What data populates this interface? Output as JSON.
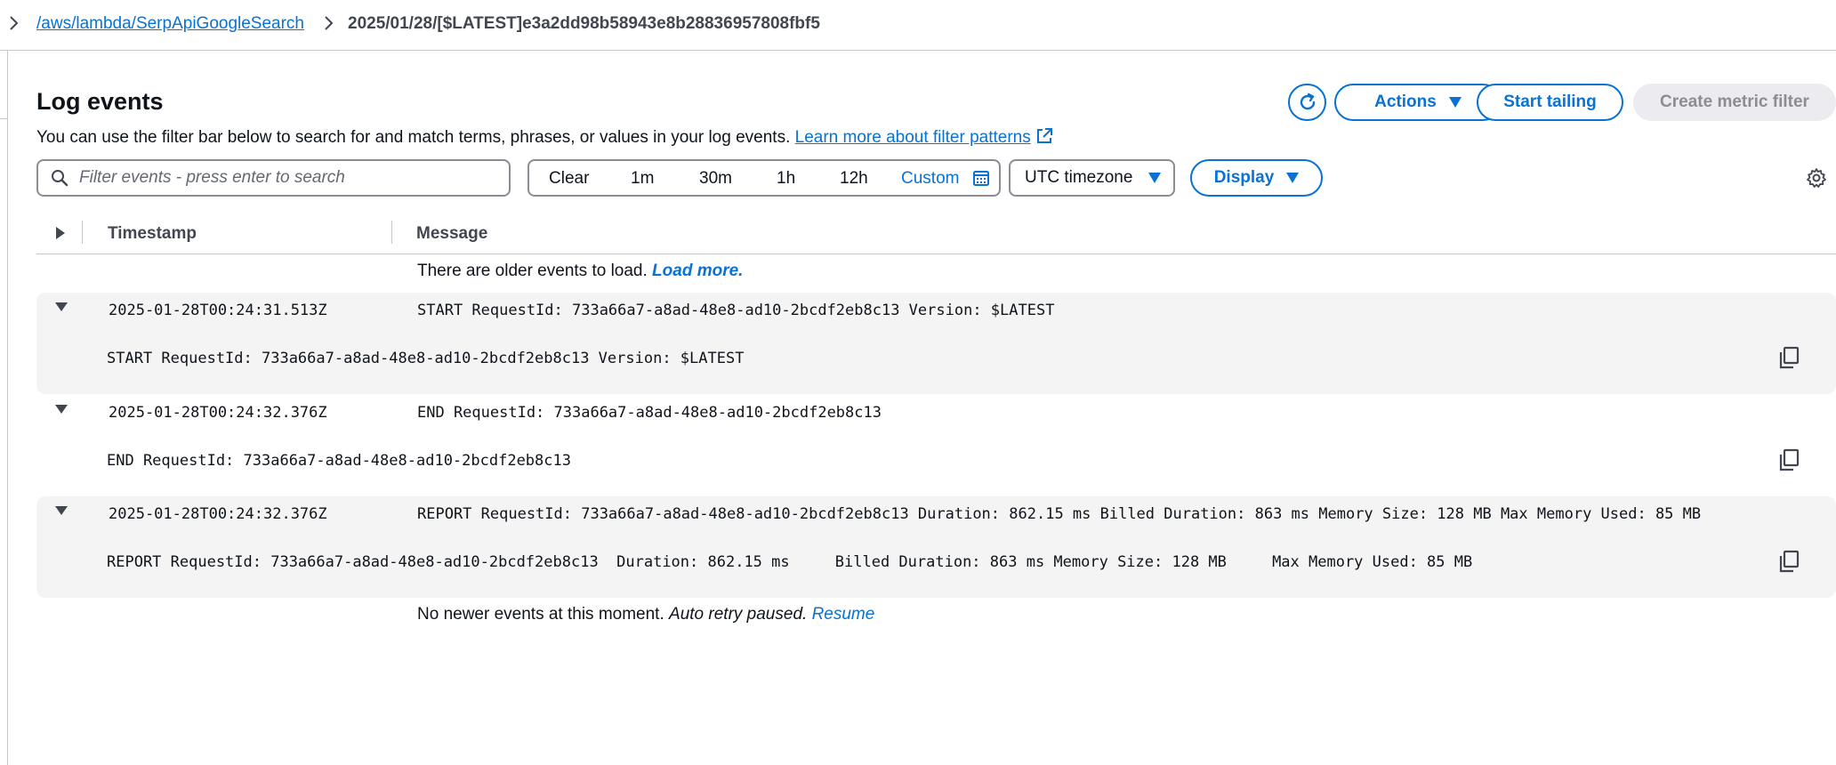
{
  "breadcrumb": {
    "log_group": "/aws/lambda/SerpApiGoogleSearch",
    "log_stream": "2025/01/28/[$LATEST]e3a2dd98b58943e8b28836957808fbf5"
  },
  "header": {
    "title": "Log events",
    "description": "You can use the filter bar below to search for and match terms, phrases, or values in your log events.",
    "learn_more": "Learn more about filter patterns"
  },
  "toolbar": {
    "actions_label": "Actions",
    "start_tailing_label": "Start tailing",
    "create_metric_filter_label": "Create metric filter"
  },
  "filter": {
    "placeholder": "Filter events - press enter to search",
    "range": {
      "clear": "Clear",
      "options": [
        "1m",
        "30m",
        "1h",
        "12h"
      ],
      "custom": "Custom"
    },
    "timezone": "UTC timezone",
    "display_label": "Display"
  },
  "table": {
    "columns": [
      "Timestamp",
      "Message"
    ],
    "older_notice": "There are older events to load.",
    "load_more": "Load more.",
    "newer_notice": "No newer events at this moment.",
    "auto_retry": "Auto retry paused.",
    "resume": "Resume",
    "events": [
      {
        "timestamp": "2025-01-28T00:24:31.513Z",
        "message": "START RequestId: 733a66a7-a8ad-48e8-ad10-2bcdf2eb8c13 Version: $LATEST",
        "detail": "START RequestId: 733a66a7-a8ad-48e8-ad10-2bcdf2eb8c13 Version: $LATEST"
      },
      {
        "timestamp": "2025-01-28T00:24:32.376Z",
        "message": "END RequestId: 733a66a7-a8ad-48e8-ad10-2bcdf2eb8c13",
        "detail": "END RequestId: 733a66a7-a8ad-48e8-ad10-2bcdf2eb8c13"
      },
      {
        "timestamp": "2025-01-28T00:24:32.376Z",
        "message": "REPORT RequestId: 733a66a7-a8ad-48e8-ad10-2bcdf2eb8c13 Duration: 862.15 ms Billed Duration: 863 ms Memory Size: 128 MB Max Memory Used: 85 MB",
        "detail": "REPORT RequestId: 733a66a7-a8ad-48e8-ad10-2bcdf2eb8c13  Duration: 862.15 ms     Billed Duration: 863 ms Memory Size: 128 MB     Max Memory Used: 85 MB"
      }
    ]
  },
  "colors": {
    "link": "#0972d3",
    "border": "#8c8c94",
    "row_bg": "#f4f4f4",
    "disabled_bg": "#ebebf0"
  }
}
